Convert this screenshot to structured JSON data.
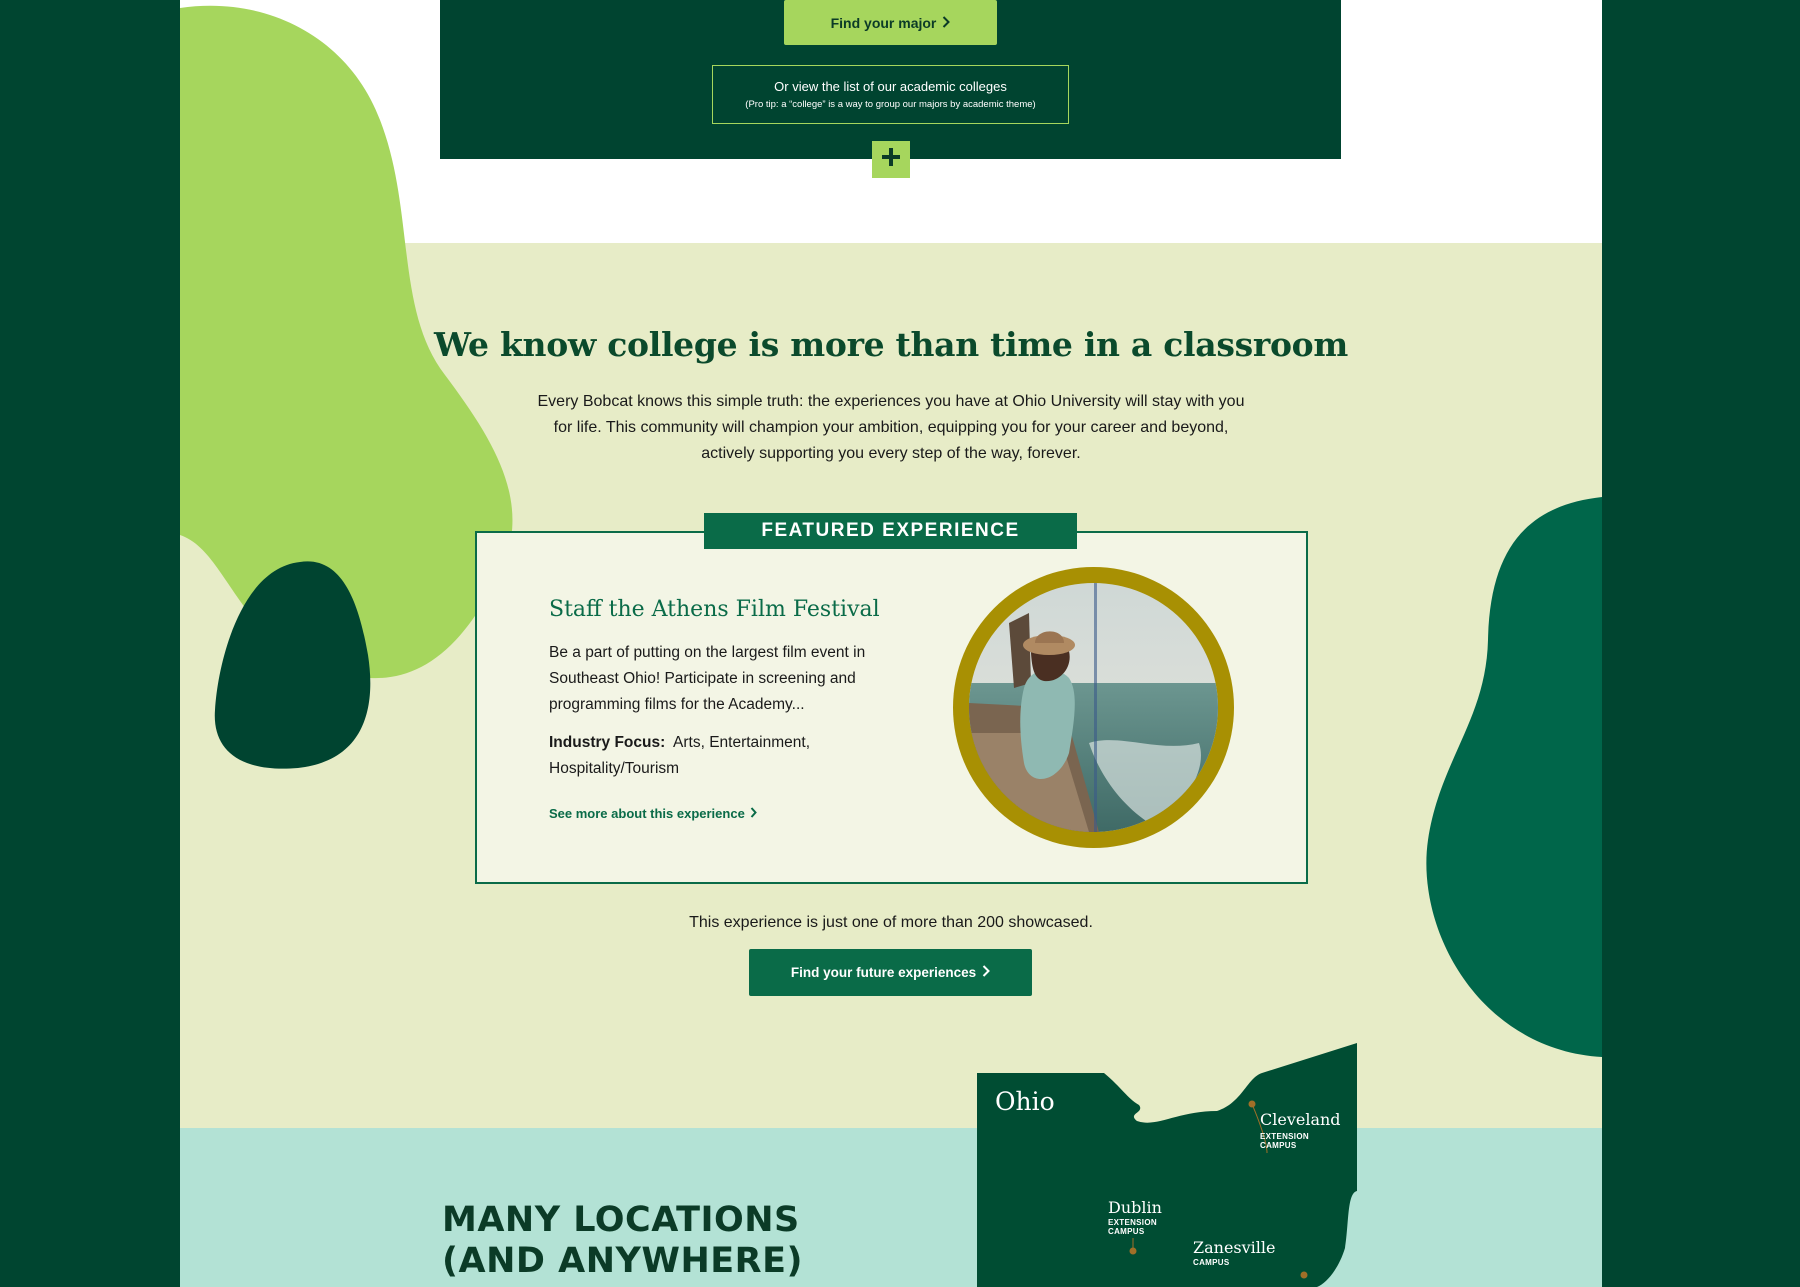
{
  "top_panel": {
    "find_major_label": "Find your major",
    "colleges_link": "Or view the list of our academic colleges",
    "colleges_tip": "(Pro tip: a “college” is a way to group our majors by academic theme)",
    "expand_icon": "plus-icon"
  },
  "experiences": {
    "title": "We know college is more than time in a classroom",
    "body": "Every Bobcat knows this simple truth: the experiences you have at Ohio University will stay with you for life. This community will champion your ambition, equipping you for your career and beyond, actively supporting you every step of the way, forever.",
    "featured_label": "FEATURED EXPERIENCE",
    "featured": {
      "title": "Staff the Athens Film Festival",
      "description": "Be a part of putting on the largest film event in Southeast Ohio! Participate in screening and programming films for the Academy...",
      "focus_label": "Industry Focus:",
      "focus_value": "Arts, Entertainment, Hospitality/Tourism",
      "link_label": "See more about this experience"
    },
    "showcase_text": "This experience is just one of more than 200 showcased.",
    "future_button": "Find your future experiences"
  },
  "locations": {
    "title_line1": "MANY LOCATIONS",
    "title_line2": "(AND ANYWHERE)",
    "map": {
      "state_label": "Ohio",
      "cities": [
        {
          "name": "Cleveland",
          "sub1": "EXTENSION",
          "sub2": "CAMPUS"
        },
        {
          "name": "Dublin",
          "sub1": "EXTENSION",
          "sub2": "CAMPUS"
        },
        {
          "name": "Zanesville",
          "sub1": "CAMPUS",
          "sub2": ""
        }
      ]
    }
  },
  "colors": {
    "dark_green": "#004430",
    "medium_green": "#0a6b48",
    "lime": "#a6d65d",
    "cream": "#e7ecc7",
    "mint": "#b3e2d5",
    "gold": "#a89003"
  }
}
